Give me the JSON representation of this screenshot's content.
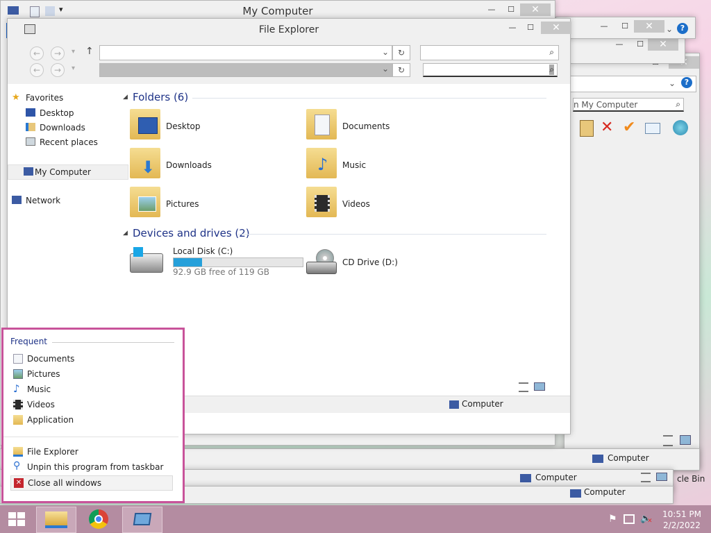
{
  "windows": {
    "my_computer": {
      "title": "My Computer",
      "status_location": "Computer",
      "search_placeholder": "n My Computer",
      "truncated_item": "s"
    },
    "file_explorer": {
      "title": "File Explorer",
      "status_location": "Computer"
    },
    "back_window_status_1": "Computer",
    "back_window_status_2": "Computer",
    "desktop_recycle_label": "cle Bin"
  },
  "nav_pane": {
    "favorites": "Favorites",
    "items": [
      "Desktop",
      "Downloads",
      "Recent places"
    ],
    "my_computer": "My Computer",
    "network": "Network"
  },
  "content": {
    "folders_header": "Folders (6)",
    "folders": [
      {
        "label": "Desktop",
        "icon": "desktop-folder-icon"
      },
      {
        "label": "Documents",
        "icon": "documents-folder-icon"
      },
      {
        "label": "Downloads",
        "icon": "downloads-folder-icon"
      },
      {
        "label": "Music",
        "icon": "music-folder-icon"
      },
      {
        "label": "Pictures",
        "icon": "pictures-folder-icon"
      },
      {
        "label": "Videos",
        "icon": "videos-folder-icon"
      }
    ],
    "devices_header": "Devices and drives (2)",
    "drives": [
      {
        "label": "Local Disk (C:)",
        "free": "92.9 GB free of 119 GB",
        "used_fraction": 0.22
      },
      {
        "label": "CD Drive (D:)"
      }
    ]
  },
  "jump_list": {
    "header": "Frequent",
    "frequent": [
      "Documents",
      "Pictures",
      "Music",
      "Videos",
      "Application"
    ],
    "tasks": [
      "File Explorer",
      "Unpin this program from taskbar",
      "Close all windows"
    ]
  },
  "taskbar": {
    "time": "10:51 PM",
    "date": "2/2/2022"
  },
  "colors": {
    "accent": "#1e3287",
    "jump_border": "#c8539a",
    "taskbar": "#b48ca1",
    "disk_bar": "#26a0da"
  }
}
